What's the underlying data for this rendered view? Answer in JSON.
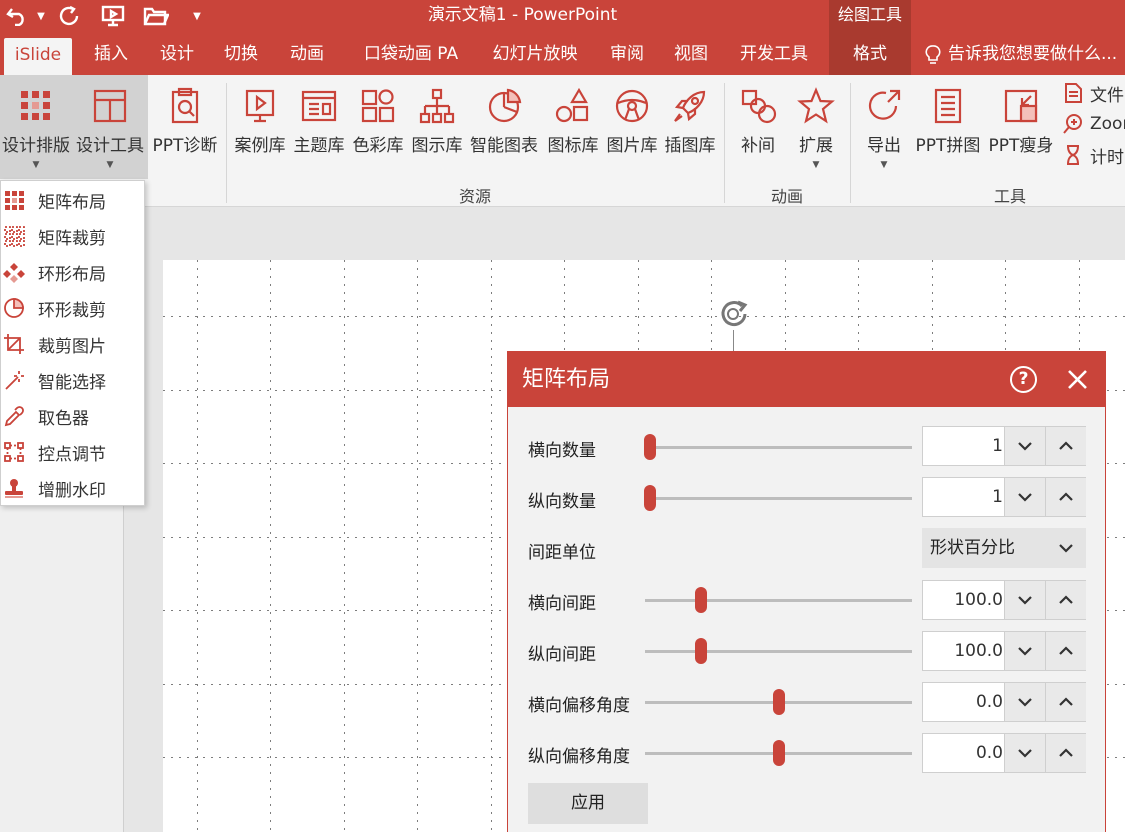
{
  "window": {
    "title": "演示文稿1 - PowerPoint",
    "context_header": "绘图工具"
  },
  "tabs": [
    {
      "label": "iSlide"
    },
    {
      "label": "插入"
    },
    {
      "label": "设计"
    },
    {
      "label": "切换"
    },
    {
      "label": "动画"
    },
    {
      "label": "口袋动画 PA"
    },
    {
      "label": "幻灯片放映"
    },
    {
      "label": "审阅"
    },
    {
      "label": "视图"
    },
    {
      "label": "开发工具"
    },
    {
      "label": "格式"
    }
  ],
  "tell_me": "告诉我您想要做什么...",
  "ribbon": {
    "buttons": [
      {
        "label": "设计排版"
      },
      {
        "label": "设计工具"
      },
      {
        "label": "PPT诊断"
      },
      {
        "label": "案例库"
      },
      {
        "label": "主题库"
      },
      {
        "label": "色彩库"
      },
      {
        "label": "图示库"
      },
      {
        "label": "智能图表"
      },
      {
        "label": "图标库"
      },
      {
        "label": "图片库"
      },
      {
        "label": "插图库"
      },
      {
        "label": "补间"
      },
      {
        "label": "扩展"
      },
      {
        "label": "导出"
      },
      {
        "label": "PPT拼图"
      },
      {
        "label": "PPT瘦身"
      }
    ],
    "small_buttons": [
      {
        "label": "文件"
      },
      {
        "label": "Zoom"
      },
      {
        "label": "计时"
      }
    ],
    "groups": [
      {
        "label": "资源"
      },
      {
        "label": "动画"
      },
      {
        "label": "工具"
      }
    ]
  },
  "menu": {
    "items": [
      {
        "label": "矩阵布局",
        "icon": "matrix-layout-icon"
      },
      {
        "label": "矩阵裁剪",
        "icon": "matrix-crop-icon"
      },
      {
        "label": "环形布局",
        "icon": "ring-layout-icon"
      },
      {
        "label": "环形裁剪",
        "icon": "ring-crop-icon"
      },
      {
        "label": "裁剪图片",
        "icon": "crop-image-icon"
      },
      {
        "label": "智能选择",
        "icon": "magic-wand-icon"
      },
      {
        "label": "取色器",
        "icon": "eyedropper-icon"
      },
      {
        "label": "控点调节",
        "icon": "control-points-icon"
      },
      {
        "label": "增删水印",
        "icon": "stamp-icon"
      }
    ]
  },
  "dialog": {
    "title": "矩阵布局",
    "help": "?",
    "rows": [
      {
        "label": "横向数量",
        "value": "1",
        "slider_fraction": 0.02
      },
      {
        "label": "纵向数量",
        "value": "1",
        "slider_fraction": 0.02
      },
      {
        "label": "间距单位",
        "select_value": "形状百分比"
      },
      {
        "label": "横向间距",
        "value": "100.0",
        "slider_fraction": 0.21
      },
      {
        "label": "纵向间距",
        "value": "100.0",
        "slider_fraction": 0.21
      },
      {
        "label": "横向偏移角度",
        "value": "0.0",
        "slider_fraction": 0.5
      },
      {
        "label": "纵向偏移角度",
        "value": "0.0",
        "slider_fraction": 0.5
      }
    ],
    "apply_label": "应用"
  },
  "colors": {
    "accent": "#c9443a",
    "ribbon_bg": "#f4f4f4"
  }
}
